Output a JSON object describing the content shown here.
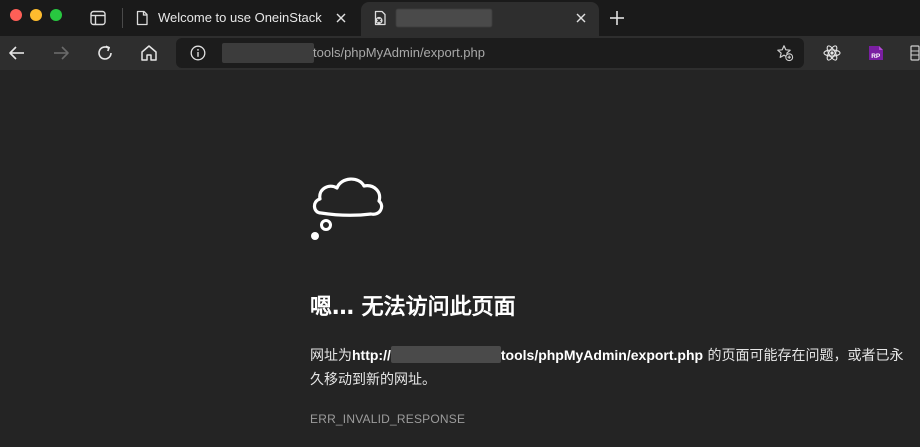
{
  "tabs": [
    {
      "title": "Welcome to use OneinStack",
      "state": "inactive",
      "icon": "page-icon"
    },
    {
      "title": "",
      "state": "active",
      "icon": "broken-page-icon"
    }
  ],
  "address": {
    "url_visible": "tools/phpMyAdmin/export.php"
  },
  "error": {
    "heading": "嗯… 无法访问此页面",
    "line_prefix": "网址为",
    "url_prefix": "http://",
    "url_suffix": "tools/phpMyAdmin/export.php",
    "line_suffix": " 的页面可能存在问题，或者已永久移动到新的网址。",
    "code": "ERR_INVALID_RESPONSE"
  },
  "colors": {
    "background": "#242424",
    "tabbar": "#1a1a1a",
    "toolbar": "#2e2e2e",
    "accent_purple": "#7a1fa2"
  }
}
